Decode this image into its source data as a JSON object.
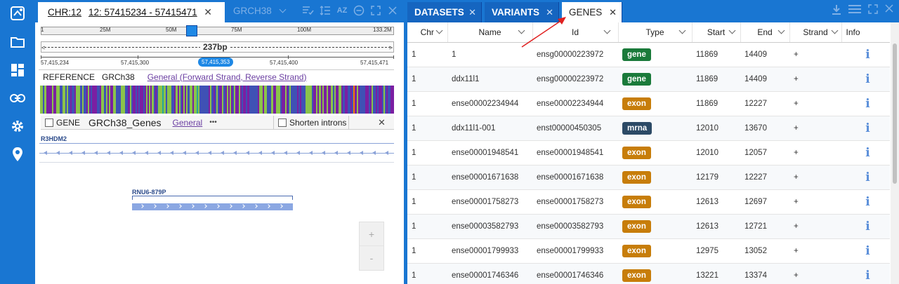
{
  "sidebar": {
    "items": [
      {
        "icon": "logo-icon"
      },
      {
        "icon": "folder-icon"
      },
      {
        "icon": "dashboard-icon"
      },
      {
        "icon": "link-icon"
      },
      {
        "icon": "gear-icon"
      },
      {
        "icon": "location-pin-icon"
      }
    ]
  },
  "browser": {
    "tab_chr": "CHR:12",
    "tab_range": "12: 57415234 - 57415471",
    "tab_close": "✕",
    "tab2_label": "GRCH38",
    "ruler": {
      "ticks": [
        "1",
        "25M",
        "50M",
        "75M",
        "100M",
        "133.2M"
      ],
      "span_label": "237bp",
      "pos_left": "57,415,234",
      "pos_mid1": "57,415,300",
      "pos_center": "57,415,353",
      "pos_mid2": "57,415,400",
      "pos_right": "57,415,471"
    },
    "reference": {
      "label": "REFERENCE",
      "assembly": "GRCh38",
      "link": "General (Forward Strand, Reverse Strand)"
    },
    "gene_track": {
      "checkbox_label": "GENE",
      "name": "GRCh38_Genes",
      "link": "General",
      "more": "•••",
      "shorten_label": "Shorten introns",
      "close": "✕",
      "gene1": "R3HDM2",
      "gene2": "RNU6-879P"
    },
    "zoom_in": "+",
    "zoom_out": "-"
  },
  "right": {
    "tabs": [
      {
        "label": "DATASETS",
        "close": "✕"
      },
      {
        "label": "VARIANTS",
        "close": "✕"
      },
      {
        "label": "GENES",
        "close": "✕"
      }
    ],
    "columns": [
      "Chr",
      "Name",
      "Id",
      "Type",
      "Start",
      "End",
      "Strand",
      "Info"
    ],
    "rows": [
      {
        "chr": "1",
        "name": "1",
        "id": "ensg00000223972",
        "type": "gene",
        "start": "11869",
        "end": "14409",
        "strand": "+",
        "info": "i"
      },
      {
        "chr": "1",
        "name": "ddx11l1",
        "id": "ensg00000223972",
        "type": "gene",
        "start": "11869",
        "end": "14409",
        "strand": "+",
        "info": "i"
      },
      {
        "chr": "1",
        "name": "ense00002234944",
        "id": "ense00002234944",
        "type": "exon",
        "start": "11869",
        "end": "12227",
        "strand": "+",
        "info": "i"
      },
      {
        "chr": "1",
        "name": "ddx11l1-001",
        "id": "enst00000450305",
        "type": "mrna",
        "start": "12010",
        "end": "13670",
        "strand": "+",
        "info": "i"
      },
      {
        "chr": "1",
        "name": "ense00001948541",
        "id": "ense00001948541",
        "type": "exon",
        "start": "12010",
        "end": "12057",
        "strand": "+",
        "info": "i"
      },
      {
        "chr": "1",
        "name": "ense00001671638",
        "id": "ense00001671638",
        "type": "exon",
        "start": "12179",
        "end": "12227",
        "strand": "+",
        "info": "i"
      },
      {
        "chr": "1",
        "name": "ense00001758273",
        "id": "ense00001758273",
        "type": "exon",
        "start": "12613",
        "end": "12697",
        "strand": "+",
        "info": "i"
      },
      {
        "chr": "1",
        "name": "ense00003582793",
        "id": "ense00003582793",
        "type": "exon",
        "start": "12613",
        "end": "12721",
        "strand": "+",
        "info": "i"
      },
      {
        "chr": "1",
        "name": "ense00001799933",
        "id": "ense00001799933",
        "type": "exon",
        "start": "12975",
        "end": "13052",
        "strand": "+",
        "info": "i"
      },
      {
        "chr": "1",
        "name": "ense00001746346",
        "id": "ense00001746346",
        "type": "exon",
        "start": "13221",
        "end": "13374",
        "strand": "+",
        "info": "i"
      }
    ]
  },
  "colors": {
    "primary": "#1976d2",
    "gene": "#1a7a3a",
    "exon": "#c77d0a",
    "mrna": "#2c4a66",
    "annotation_arrow": "#e02020"
  }
}
